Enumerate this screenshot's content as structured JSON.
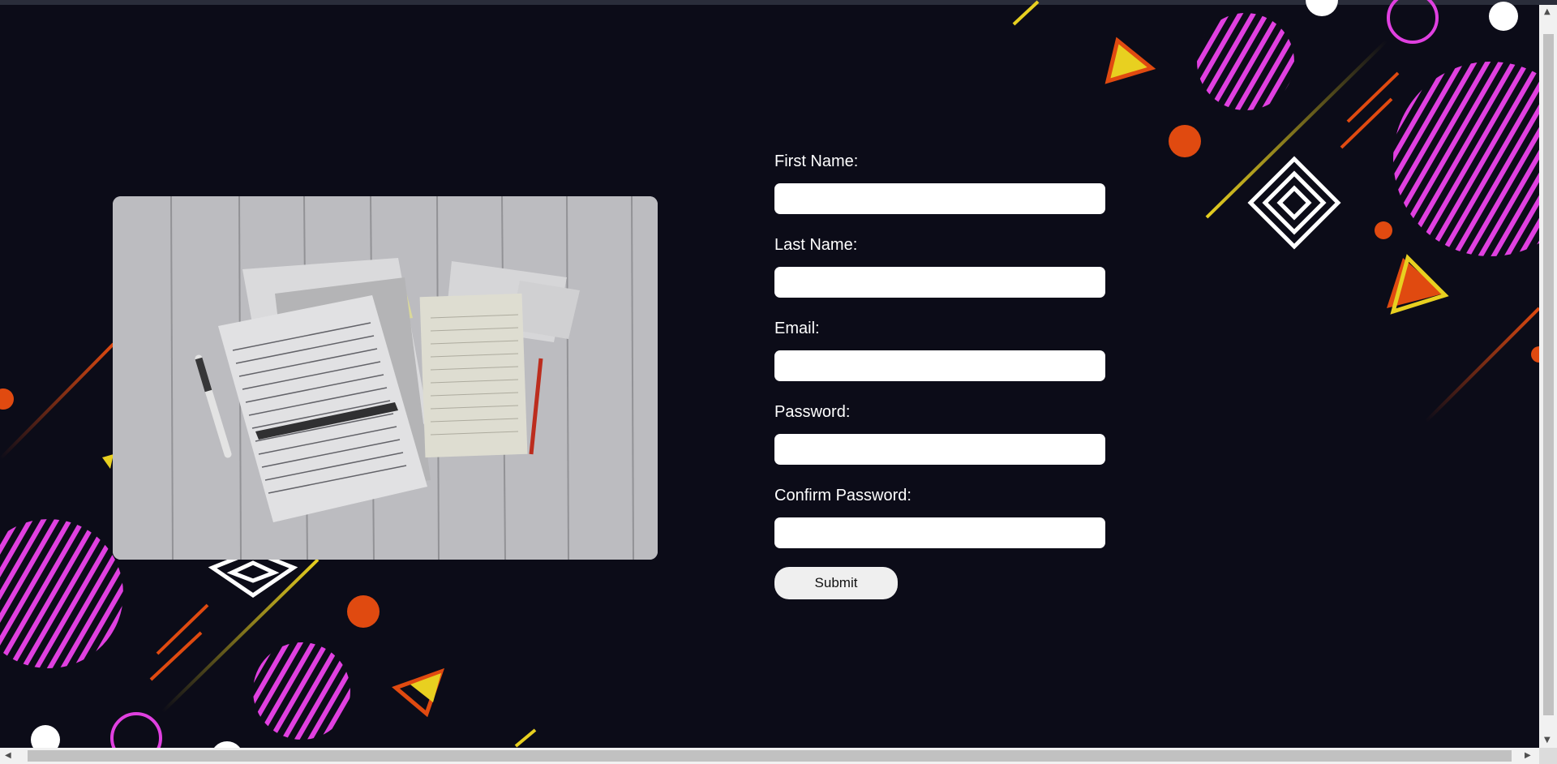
{
  "form": {
    "fields": [
      {
        "label": "First Name:",
        "value": "",
        "type": "text"
      },
      {
        "label": "Last Name:",
        "value": "",
        "type": "text"
      },
      {
        "label": "Email:",
        "value": "",
        "type": "email"
      },
      {
        "label": "Password:",
        "value": "",
        "type": "password"
      },
      {
        "label": "Confirm Password:",
        "value": "",
        "type": "password"
      }
    ],
    "submit_label": "Submit"
  },
  "colors": {
    "background": "#0c0c18",
    "magenta": "#e040e0",
    "orange": "#e04a10",
    "yellow": "#e8d020",
    "white": "#ffffff"
  },
  "icons": {
    "scroll_up": "scroll-up-arrow-icon",
    "scroll_down": "scroll-down-arrow-icon",
    "scroll_left": "scroll-left-arrow-icon",
    "scroll_right": "scroll-right-arrow-icon"
  }
}
